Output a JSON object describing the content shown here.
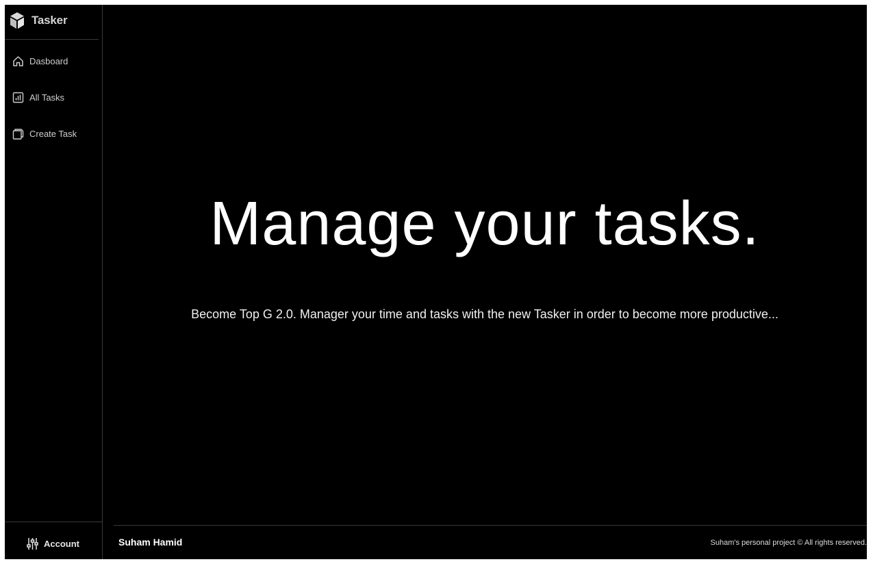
{
  "app": {
    "name": "Tasker"
  },
  "sidebar": {
    "items": [
      {
        "label": "Dasboard",
        "icon": "home-icon"
      },
      {
        "label": "All Tasks",
        "icon": "bar-chart-icon"
      },
      {
        "label": "Create Task",
        "icon": "copy-icon"
      }
    ],
    "account": {
      "label": "Account",
      "icon": "sliders-icon"
    }
  },
  "hero": {
    "title": "Manage your tasks.",
    "subtitle": "Become Top G 2.0. Manager your time and tasks with the new Tasker in order to become more productive..."
  },
  "footer": {
    "name": "Suham Hamid",
    "copyright": "Suham's personal project © All rights reserved."
  },
  "colors": {
    "background": "#000000",
    "text": "#ffffff",
    "divider": "#3a3a3a"
  }
}
